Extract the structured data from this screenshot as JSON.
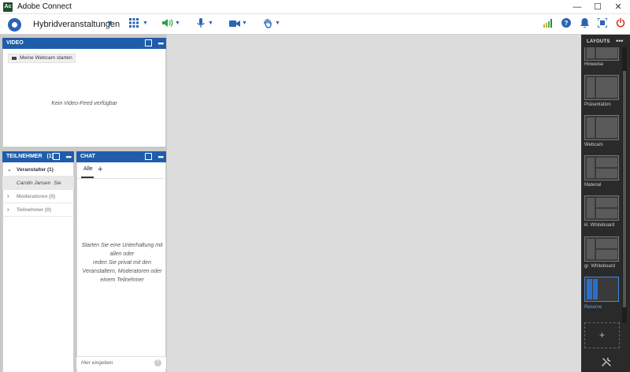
{
  "window": {
    "title": "Adobe Connect",
    "logo_text": "Ac"
  },
  "window_controls": {
    "minimize": "—",
    "maximize": "☐",
    "close": "✕"
  },
  "toolbar": {
    "room_name": "Hybridveranstaltungen",
    "icons": [
      "apps-grid-icon",
      "speaker-icon",
      "microphone-icon",
      "camera-icon",
      "raise-hand-icon"
    ],
    "right_icons": [
      "signal-bars-icon",
      "help-icon",
      "notifications-icon",
      "fullscreen-icon",
      "power-icon"
    ]
  },
  "video_pod": {
    "title": "VIDEO",
    "webcam_button": "Meine Webcam starten",
    "empty_message": "Kein Video-Feed verfügbar"
  },
  "attendees_pod": {
    "title": "TEILNEHMER",
    "count": "(1)",
    "groups": [
      {
        "label": "Veranstalter (1)",
        "expanded": true
      },
      {
        "label": "Moderatoren (0)",
        "expanded": false
      },
      {
        "label": "Teilnehmer (0)",
        "expanded": false
      }
    ],
    "members": [
      {
        "name": "Carolin Jansen",
        "suffix": "Sie"
      }
    ]
  },
  "chat_pod": {
    "title": "CHAT",
    "tabs": [
      {
        "label": "Alle"
      }
    ],
    "add_tab": "+",
    "empty_lines": [
      "Starten Sie eine Unterhaltung mit",
      "allen oder",
      "reden Sie privat mit den",
      "Veranstaltern, Moderatoren oder",
      "einem Teilnehmer"
    ],
    "input_placeholder": "Hier eingeben",
    "help_glyph": "?"
  },
  "layouts_rail": {
    "title": "LAYOUTS",
    "items": [
      {
        "label": "Hinweise",
        "active": false
      },
      {
        "label": "Präsentation",
        "active": false
      },
      {
        "label": "Webcam",
        "active": false
      },
      {
        "label": "Material",
        "active": false
      },
      {
        "label": "kl. Whiteboard",
        "active": false
      },
      {
        "label": "gr. Whiteboard",
        "active": false
      },
      {
        "label": "Reserve",
        "active": true
      }
    ],
    "add_label": "+"
  },
  "colors": {
    "pod_header": "#1f5dab",
    "accent": "#2b64b3",
    "rail_bg": "#2a2a2a",
    "active_layout": "#3d8ae0",
    "power": "#d93a2b",
    "signal": "#4caf50"
  }
}
